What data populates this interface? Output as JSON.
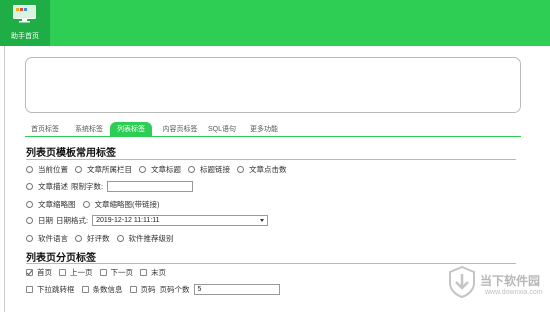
{
  "topbar": {
    "home_label": "助手首页",
    "accent": "#2ece55"
  },
  "tabs": [
    {
      "label": "首页标签",
      "active": false
    },
    {
      "label": "系统标签",
      "active": false
    },
    {
      "label": "列表标签",
      "active": true
    },
    {
      "label": "内容页标签",
      "active": false
    },
    {
      "label": "SQL语句",
      "active": false
    },
    {
      "label": "更多功能",
      "active": false
    }
  ],
  "section1": {
    "title": "列表页模板常用标签",
    "row1": [
      "当前位置",
      "文章所属栏目",
      "文章标题",
      "标题链接",
      "文章点击数"
    ],
    "row2": {
      "option": "文章描述",
      "limit_label": "限制字数:",
      "limit_value": ""
    },
    "row3": [
      "文章缩略图",
      "文章缩略图(带链接)"
    ],
    "row4": {
      "option": "日期",
      "format_label": "日期格式:",
      "format_value": "2019-12-12 11:11:11"
    },
    "row5": [
      "软件语言",
      "好评数",
      "软件推荐级别"
    ]
  },
  "section2": {
    "title": "列表页分页标签",
    "row1": [
      {
        "label": "首页",
        "checked": true
      },
      {
        "label": "上一页",
        "checked": false
      },
      {
        "label": "下一页",
        "checked": false
      },
      {
        "label": "末页",
        "checked": false
      }
    ],
    "row2": {
      "items": [
        {
          "label": "下拉跳转框",
          "checked": false
        },
        {
          "label": "条数信息",
          "checked": false
        },
        {
          "label": "页码",
          "checked": false
        }
      ],
      "count_label": "页码个数",
      "count_value": "5"
    }
  },
  "watermark": {
    "title": "当下软件园",
    "url": "www.downxia.com"
  }
}
